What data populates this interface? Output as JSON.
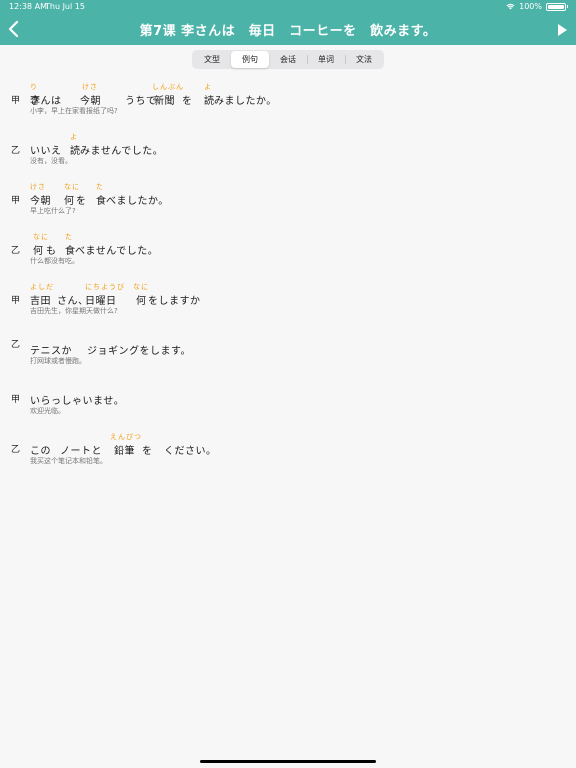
{
  "status": {
    "time": "12:38 AM",
    "date": "Thu Jul 15",
    "battery": "100%"
  },
  "header": {
    "title": "第7课 李さんは　毎日　コーヒーを　飲みます。"
  },
  "tabs": [
    {
      "label": "文型",
      "active": false
    },
    {
      "label": "例句",
      "active": true
    },
    {
      "label": "会话",
      "active": false
    },
    {
      "label": "单词",
      "active": false
    },
    {
      "label": "文法",
      "active": false
    }
  ],
  "sentences": [
    {
      "speaker": "甲",
      "chunks": [
        {
          "ruby": "り",
          "base": "李"
        },
        {
          "ruby": "",
          "base": "さんは"
        },
        {
          "ruby": "けさ",
          "base": "今朝"
        },
        {
          "ruby": "",
          "base": "うちで"
        },
        {
          "ruby": "しんぶん",
          "base": "新聞"
        },
        {
          "ruby": "",
          "base": "を"
        },
        {
          "ruby": "よ",
          "base": "読"
        },
        {
          "ruby": "",
          "base": "みましたか。"
        }
      ],
      "translation": "小李，早上在家看报纸了吗?"
    },
    {
      "speaker": "乙",
      "chunks": [
        {
          "ruby": "",
          "base": "いいえ"
        },
        {
          "ruby": "よ",
          "base": "読"
        },
        {
          "ruby": "",
          "base": "みませんでした。"
        }
      ],
      "translation": "没有，没看。"
    },
    {
      "speaker": "甲",
      "chunks": [
        {
          "ruby": "けさ",
          "base": "今朝"
        },
        {
          "ruby": "なに",
          "base": "何"
        },
        {
          "ruby": "",
          "base": "を"
        },
        {
          "ruby": "た",
          "base": "食"
        },
        {
          "ruby": "",
          "base": "べましたか。"
        }
      ],
      "translation": "早上吃什么了?"
    },
    {
      "speaker": "乙",
      "chunks": [
        {
          "ruby": "なに",
          "base": "何"
        },
        {
          "ruby": "",
          "base": "も"
        },
        {
          "ruby": "た",
          "base": "食"
        },
        {
          "ruby": "",
          "base": "べませんでした。"
        }
      ],
      "translation": "什么都没有吃。"
    },
    {
      "speaker": "甲",
      "chunks": [
        {
          "ruby": "よしだ",
          "base": "吉田"
        },
        {
          "ruby": "",
          "base": "さん、"
        },
        {
          "ruby": "にちようび",
          "base": "日曜日"
        },
        {
          "ruby": "なに",
          "base": "何"
        },
        {
          "ruby": "",
          "base": "をしますか"
        }
      ],
      "translation": "吉田先生，你星期天做什么?"
    },
    {
      "speaker": "乙",
      "chunks": [
        {
          "ruby": "",
          "base": "テニスか"
        },
        {
          "ruby": "",
          "base": "ジョギングをします。"
        }
      ],
      "translation": "打网球或者慢跑。"
    },
    {
      "speaker": "甲",
      "chunks": [
        {
          "ruby": "",
          "base": "いらっしゃいませ。"
        }
      ],
      "translation": "欢迎光临。"
    },
    {
      "speaker": "乙",
      "chunks": [
        {
          "ruby": "",
          "base": "この"
        },
        {
          "ruby": "",
          "base": "ノートと"
        },
        {
          "ruby": "えんぴつ",
          "base": "鉛筆"
        },
        {
          "ruby": "",
          "base": "を"
        },
        {
          "ruby": "",
          "base": "ください。"
        }
      ],
      "translation": "我买这个笔记本和铅笔。"
    }
  ]
}
